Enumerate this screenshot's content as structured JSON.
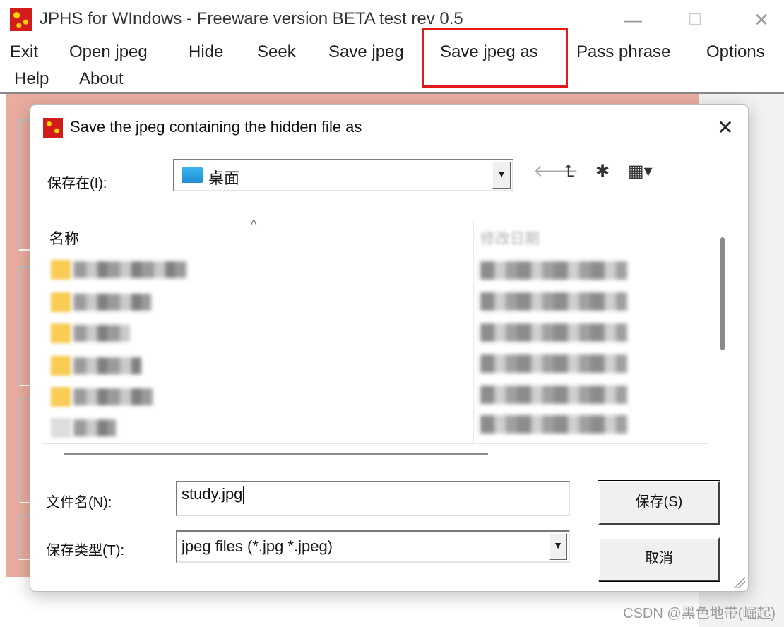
{
  "app": {
    "title": "JPHS for WIndows - Freeware version BETA test rev 0.5",
    "minimize": "—",
    "maximize": "☐",
    "close": "✕"
  },
  "menu": {
    "items": [
      "Exit",
      "Open jpeg",
      "Hide",
      "Seek",
      "Save jpeg",
      "Save jpeg as",
      "Pass phrase",
      "Options",
      "Help",
      "About"
    ],
    "highlighted": "Save jpeg as",
    "highlight_color": "#e21a1a"
  },
  "dialog": {
    "title": "Save the jpeg containing the hidden file as",
    "close": "✕",
    "save_in_label": "保存在(I):",
    "save_in_value": "桌面",
    "toolbar_icons": [
      "back-arrow-icon",
      "up-folder-icon",
      "new-folder-icon",
      "view-menu-icon"
    ],
    "list": {
      "col_name": "名称",
      "col_date": "修改日期"
    },
    "filename_label": "文件名(N):",
    "filename_value": "study.jpg",
    "filetype_label": "保存类型(T):",
    "filetype_value": "jpeg files (*.jpg *.jpeg)",
    "save_button": "保存(S)",
    "cancel_button": "取消"
  },
  "watermark": "CSDN @黑色地带(崛起)",
  "colors": {
    "app_background": "#e9ada0",
    "highlight": "#e21a1a"
  }
}
